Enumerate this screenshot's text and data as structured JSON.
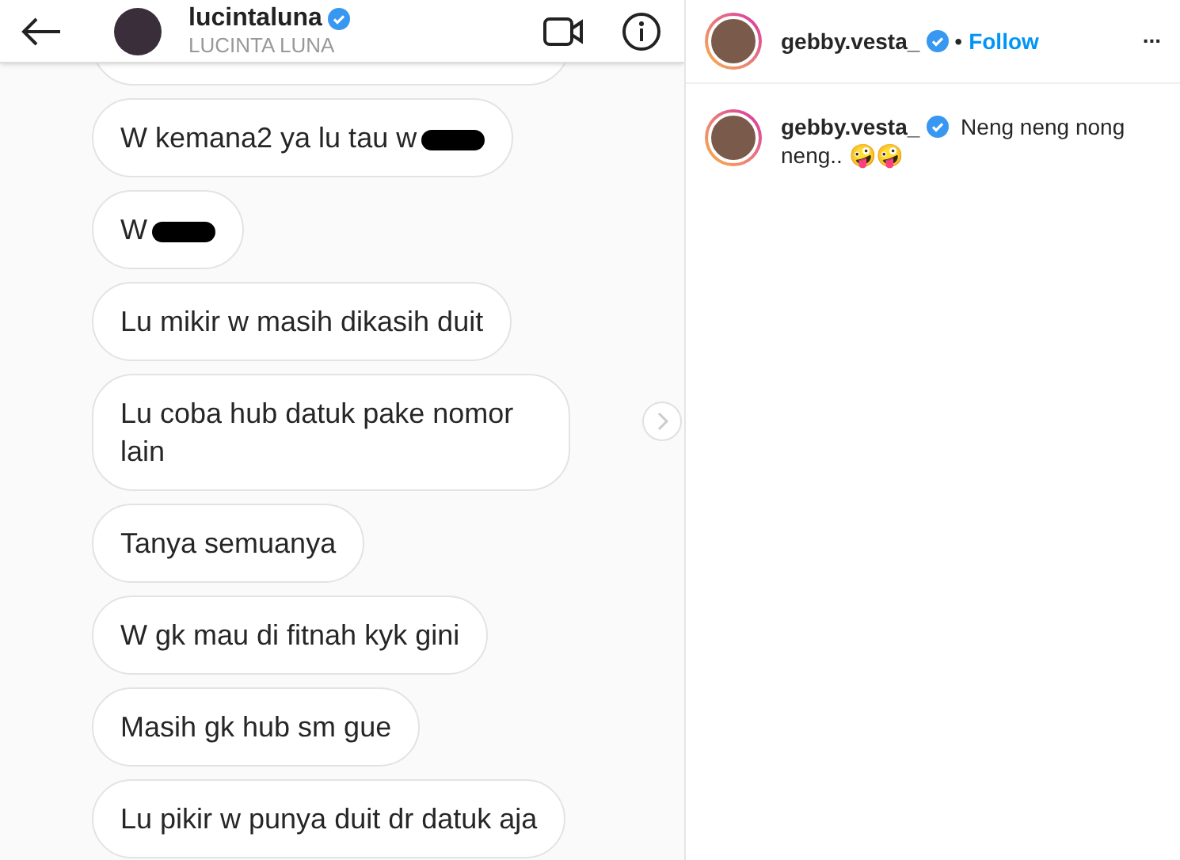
{
  "chat": {
    "username": "lucintaluna",
    "verified": true,
    "display_name": "LUCINTA LUNA",
    "messages": [
      {
        "text": "W kemana2 ya lu tau w",
        "redacted": true
      },
      {
        "text": "W",
        "redacted": true
      },
      {
        "text": "Lu mikir w masih dikasih duit",
        "redacted": false
      },
      {
        "text": "Lu coba hub datuk pake nomor lain",
        "redacted": false
      },
      {
        "text": "Tanya semuanya",
        "redacted": false
      },
      {
        "text": "W gk mau di fitnah kyk gini",
        "redacted": false
      },
      {
        "text": "Masih gk hub sm gue",
        "redacted": false
      },
      {
        "text": "Lu pikir w punya duit dr datuk aja",
        "redacted": false
      }
    ]
  },
  "post": {
    "username": "gebby.vesta_",
    "verified": true,
    "separator": "•",
    "follow": "Follow",
    "more": "...",
    "caption": {
      "username": "gebby.vesta_",
      "verified": true,
      "text": "Neng neng nong neng.. 🤪🤪"
    }
  }
}
